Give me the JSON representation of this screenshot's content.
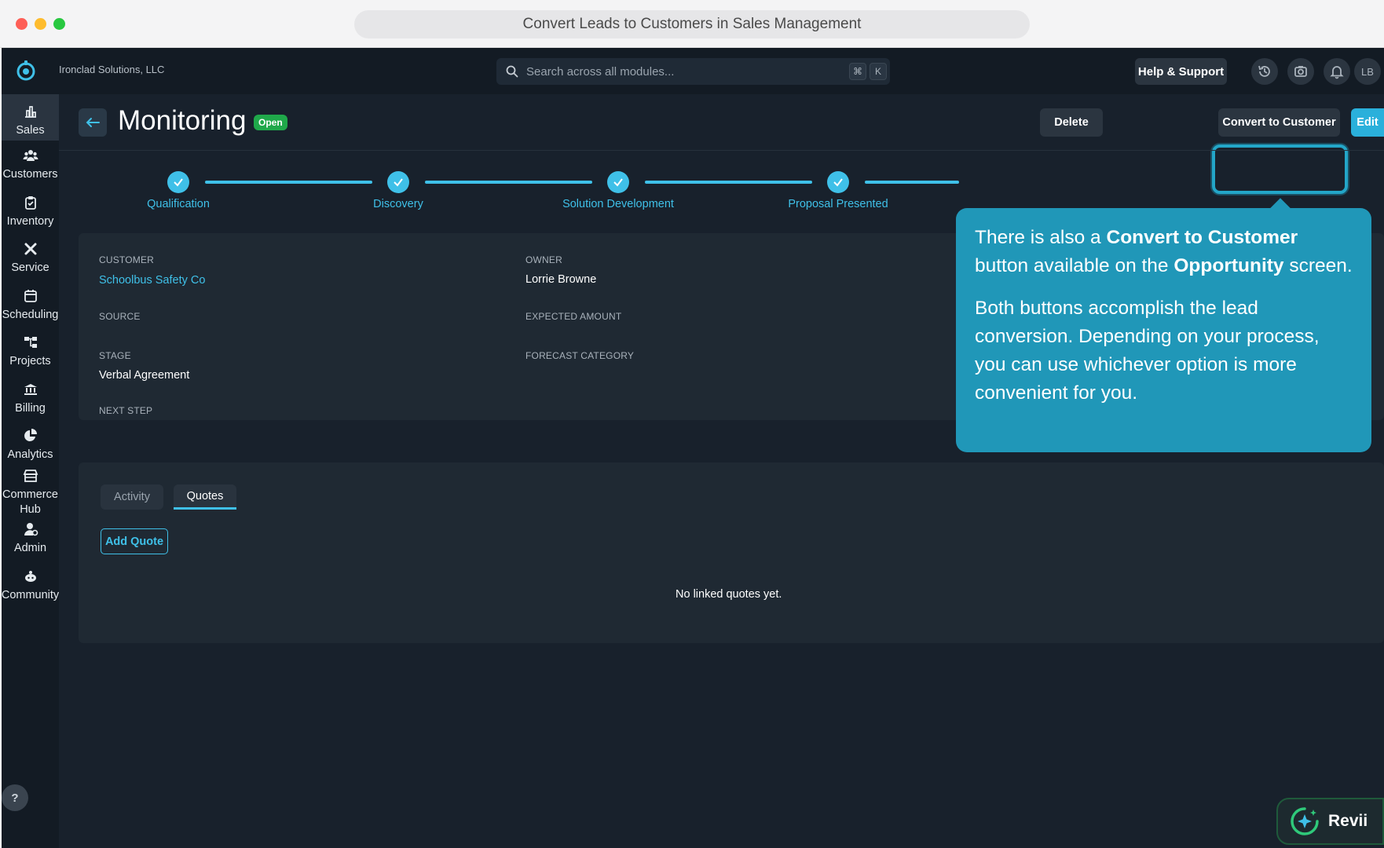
{
  "window": {
    "title": "Convert Leads to Customers in Sales Management"
  },
  "topbar": {
    "company": "Ironclad Solutions, LLC",
    "search_placeholder": "Search across all modules...",
    "kbd_cmd": "⌘",
    "kbd_k": "K",
    "help_label": "Help & Support",
    "avatar_initials": "LB"
  },
  "sidebar": {
    "items": [
      {
        "label": "Sales",
        "icon": "bar-chart-icon"
      },
      {
        "label": "Customers",
        "icon": "users-icon"
      },
      {
        "label": "Inventory",
        "icon": "clipboard-icon"
      },
      {
        "label": "Service",
        "icon": "tools-icon"
      },
      {
        "label": "Scheduling",
        "icon": "calendar-icon"
      },
      {
        "label": "Projects",
        "icon": "hierarchy-icon"
      },
      {
        "label": "Billing",
        "icon": "bank-icon"
      },
      {
        "label": "Analytics",
        "icon": "pie-chart-icon"
      },
      {
        "label": "Commerce",
        "label2": "Hub",
        "icon": "store-icon"
      },
      {
        "label": "Admin",
        "icon": "user-gear-icon"
      },
      {
        "label": "Community",
        "icon": "community-icon"
      }
    ],
    "help_glyph": "?"
  },
  "header": {
    "title": "Monitoring",
    "status": "Open",
    "delete_label": "Delete",
    "convert_label": "Convert to Customer",
    "edit_label": "Edit"
  },
  "stepper": {
    "steps": [
      "Qualification",
      "Discovery",
      "Solution Development",
      "Proposal Presented"
    ]
  },
  "details": {
    "customer_label": "CUSTOMER",
    "customer_value": "Schoolbus Safety Co",
    "owner_label": "OWNER",
    "owner_value": "Lorrie Browne",
    "source_label": "SOURCE",
    "expected_amount_label": "EXPECTED AMOUNT",
    "stage_label": "STAGE",
    "stage_value": "Verbal Agreement",
    "forecast_label": "FORECAST CATEGORY",
    "next_step_label": "NEXT STEP"
  },
  "tabs": {
    "activity": "Activity",
    "quotes": "Quotes",
    "add_quote": "Add Quote",
    "empty_text": "No linked quotes yet."
  },
  "tooltip": {
    "p1_a": "There is also a ",
    "p1_b": "Convert to Customer",
    "p1_c": " button available on the ",
    "p1_d": "Opportunity",
    "p1_e": " screen.",
    "p2": "Both buttons accomplish the lead conversion. Depending on your process, you can use whichever option is more convenient for you."
  },
  "assistant": {
    "label": "Revii"
  },
  "colors": {
    "accent": "#3fc0e8",
    "tooltip": "#2097b8",
    "open_badge": "#1fa84a",
    "background": "#18212c"
  }
}
